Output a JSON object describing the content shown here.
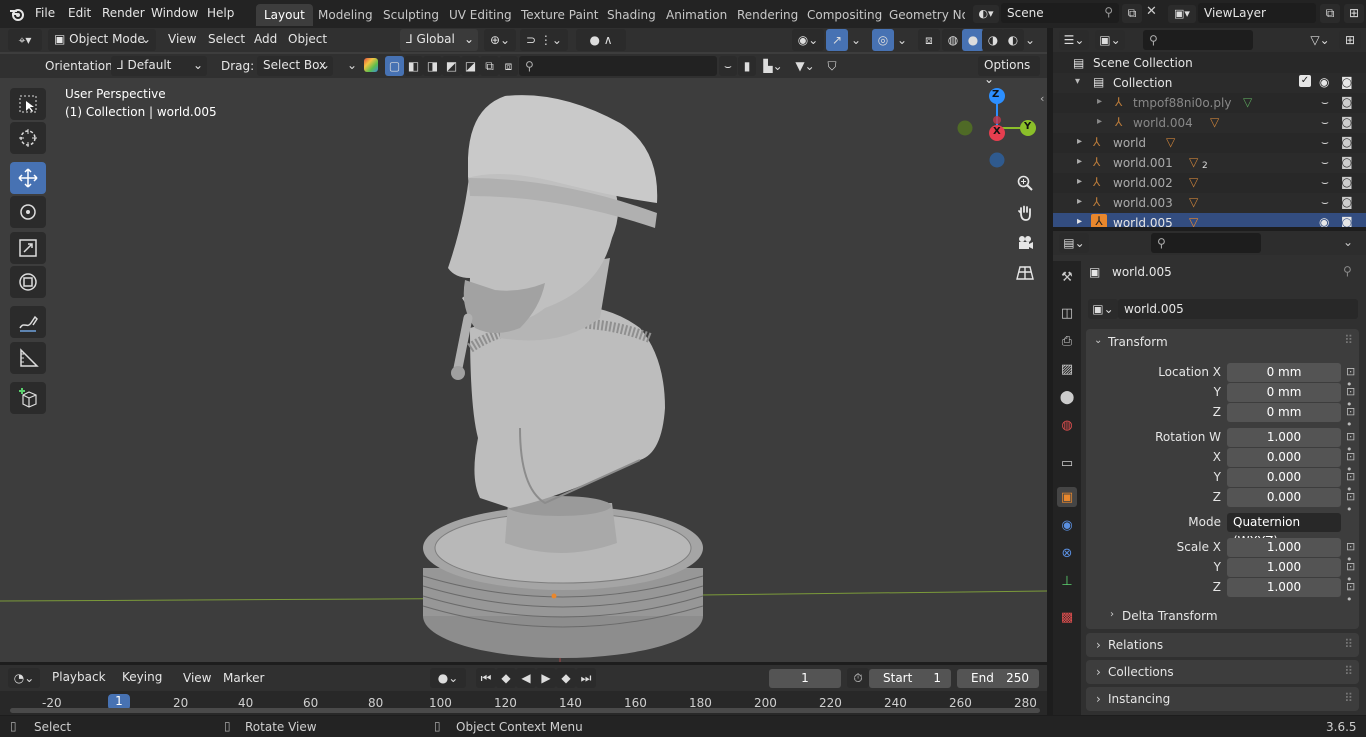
{
  "menu": {
    "items": [
      "File",
      "Edit",
      "Render",
      "Window",
      "Help"
    ]
  },
  "workspaces": [
    "Layout",
    "Modeling",
    "Sculpting",
    "UV Editing",
    "Texture Paint",
    "Shading",
    "Animation",
    "Rendering",
    "Compositing",
    "Geometry Noc"
  ],
  "scene": {
    "label": "Scene",
    "view_layer": "ViewLayer"
  },
  "viewport": {
    "mode": "Object Mode",
    "menus": [
      "View",
      "Select",
      "Add",
      "Object"
    ],
    "transform_orientation": "Global",
    "orientation_label": "Orientation:",
    "orientation_value": "Default",
    "drag_label": "Drag:",
    "drag_value": "Select Box",
    "options_label": "Options",
    "overlay_line1": "User Perspective",
    "overlay_line2": "(1) Collection | world.005",
    "gizmo": {
      "x": "X",
      "y": "Y",
      "z": "Z"
    }
  },
  "outliner": {
    "title": "Scene Collection",
    "rows": [
      {
        "label": "Collection",
        "indent": 1
      },
      {
        "label": "tmpof88ni0o.ply",
        "indent": 2
      },
      {
        "label": "world.004",
        "indent": 2
      },
      {
        "label": "world",
        "indent": 1
      },
      {
        "label": "world.001",
        "indent": 1,
        "badge": "2"
      },
      {
        "label": "world.002",
        "indent": 1
      },
      {
        "label": "world.003",
        "indent": 1
      },
      {
        "label": "world.005",
        "indent": 1
      }
    ]
  },
  "properties": {
    "object_name": "world.005",
    "object_field": "world.005",
    "transform": {
      "title": "Transform",
      "location_label": "Location X",
      "location": [
        "0 mm",
        "0 mm",
        "0 mm"
      ],
      "rotation_label": "Rotation W",
      "rotation": [
        "1.000",
        "0.000",
        "0.000",
        "0.000"
      ],
      "mode_label": "Mode",
      "mode_value": "Quaternion (WXYZ)",
      "scale_label": "Scale X",
      "scale": [
        "1.000",
        "1.000",
        "1.000"
      ],
      "axis_y": "Y",
      "axis_z": "Z",
      "axis_x": "X",
      "delta": "Delta Transform"
    },
    "sections": [
      "Relations",
      "Collections",
      "Instancing"
    ]
  },
  "timeline": {
    "menus": [
      "Playback",
      "Keying",
      "View",
      "Marker"
    ],
    "current_frame": "1",
    "start_label": "Start",
    "start": "1",
    "end_label": "End",
    "end": "250",
    "ticks": [
      "-20",
      "1",
      "20",
      "40",
      "60",
      "80",
      "100",
      "120",
      "140",
      "160",
      "180",
      "200",
      "220",
      "240",
      "260",
      "280"
    ]
  },
  "status": {
    "select": "Select",
    "rotate": "Rotate View",
    "context": "Object Context Menu",
    "version": "3.6.5"
  },
  "colors": {
    "accent": "#4772b3",
    "axis_x": "#e53e4f",
    "axis_y": "#8bbf2a",
    "axis_z": "#2c8fff",
    "object_orange": "#e8872d"
  }
}
